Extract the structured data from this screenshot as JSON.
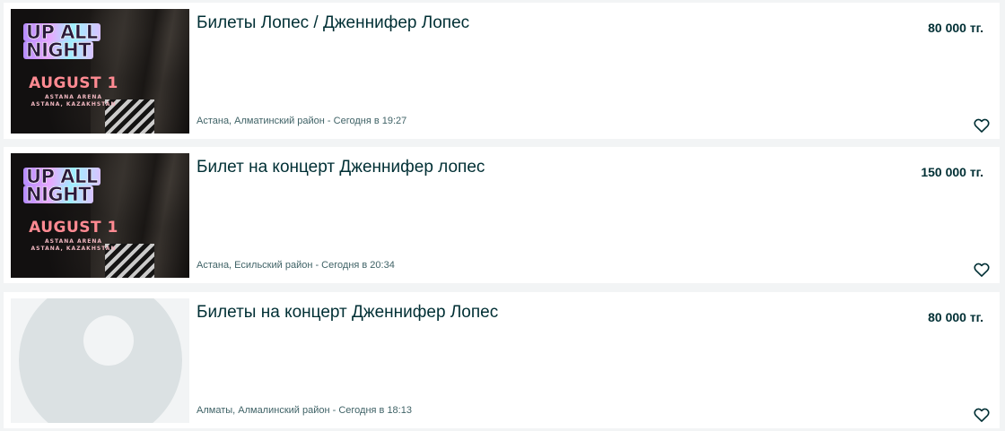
{
  "listings": [
    {
      "title": "Билеты Лопес / Дженнифер Лопес",
      "price": "80 000 тг.",
      "location_time": "Астана, Алматинский район - Сегодня в 19:27",
      "image": {
        "type": "poster",
        "headline_line1": "UP ALL",
        "headline_line2": "NIGHT",
        "date": "AUGUST 1",
        "venue_line1": "ASTANA ARENA",
        "venue_line2": "ASTANA, KAZAKHSTAN"
      },
      "favorite_icon": "heart-outline-icon"
    },
    {
      "title": "Билет на концерт Дженнифер лопес",
      "price": "150 000 тг.",
      "location_time": "Астана, Есильский район - Сегодня в 20:34",
      "image": {
        "type": "poster",
        "headline_line1": "UP ALL",
        "headline_line2": "NIGHT",
        "date": "AUGUST 1",
        "venue_line1": "ASTANA ARENA",
        "venue_line2": "ASTANA, KAZAKHSTAN"
      },
      "favorite_icon": "heart-outline-icon"
    },
    {
      "title": "Билеты на концерт Дженнифер Лопес",
      "price": "80 000 тг.",
      "location_time": "Алматы, Алмалинский район - Сегодня в 18:13",
      "image": {
        "type": "placeholder"
      },
      "favorite_icon": "heart-outline-icon"
    }
  ],
  "colors": {
    "page_background": "#f2f4f5",
    "card_background": "#ffffff",
    "text_primary": "#002f34",
    "text_secondary": "#406367",
    "placeholder_disc": "#dbe1e3"
  }
}
